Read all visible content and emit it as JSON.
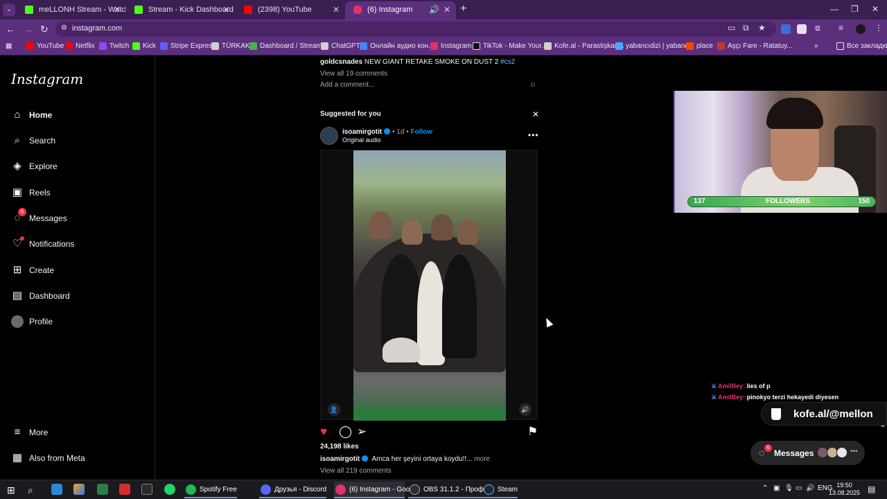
{
  "browser": {
    "tabs": [
      {
        "title": "meLLONH Stream - Watch Live",
        "color": "#53fc18"
      },
      {
        "title": "Stream - Kick Dashboard",
        "color": "#53fc18"
      },
      {
        "title": "(2398) YouTube",
        "color": "#ff0000"
      },
      {
        "title": "(6) Instagram",
        "color": "#e1306c"
      }
    ],
    "url": "instagram.com",
    "bookmarks": [
      {
        "label": "YouTube",
        "color": "#ff0000"
      },
      {
        "label": "Netflix",
        "color": "#e50914"
      },
      {
        "label": "Twitch",
        "color": "#9146ff"
      },
      {
        "label": "Kick",
        "color": "#53fc18"
      },
      {
        "label": "Stripe Express",
        "color": "#635bff"
      },
      {
        "label": "TÜRKAK",
        "color": "#d0d0d0"
      },
      {
        "label": "Dashboard / Stream...",
        "color": "#4caf50"
      },
      {
        "label": "ChatGPT",
        "color": "#d0d0d0"
      },
      {
        "label": "Онлайн аудио кон...",
        "color": "#4285f4"
      },
      {
        "label": "Instagram",
        "color": "#e1306c"
      },
      {
        "label": "TikTok - Make Your...",
        "color": "#111111"
      },
      {
        "label": "Kofe.al - Parastişkarl...",
        "color": "#d0d0d0"
      },
      {
        "label": "yabancıdizi | yabanc...",
        "color": "#4aa8ff"
      },
      {
        "label": "place",
        "color": "#ff4500"
      },
      {
        "label": "Aşçı Fare - Ratatuy...",
        "color": "#c0392b"
      }
    ],
    "all_bookmarks": "Все закладки"
  },
  "instagram": {
    "logo": "Instagram",
    "nav": [
      {
        "label": "Home",
        "icon": "home-icon"
      },
      {
        "label": "Search",
        "icon": "search-icon"
      },
      {
        "label": "Explore",
        "icon": "compass-icon"
      },
      {
        "label": "Reels",
        "icon": "reels-icon"
      },
      {
        "label": "Messages",
        "icon": "messenger-icon",
        "badge": "6"
      },
      {
        "label": "Notifications",
        "icon": "heart-icon"
      },
      {
        "label": "Create",
        "icon": "plus-square-icon"
      },
      {
        "label": "Dashboard",
        "icon": "dashboard-icon"
      },
      {
        "label": "Profile",
        "icon": "avatar-icon"
      }
    ],
    "more": "More",
    "also_from_meta": "Also from Meta",
    "prev_post": {
      "caption_user": "goldcsnades",
      "caption_text": "NEW GIANT RETAKE SMOKE ON DUST 2",
      "hashtag": "#cs2",
      "view_comments": "View all 19 comments",
      "add_comment": "Add a comment..."
    },
    "suggested": "Suggested for you",
    "post": {
      "username": "isoamirgotit",
      "time": "1d",
      "follow": "Follow",
      "audio": "Original audio",
      "likes": "24,198 likes",
      "caption_user": "isoamirgotit",
      "caption_text": "Amca her şeyini ortaya koydu!!...",
      "more": "more",
      "view_comments": "View all 219 comments"
    }
  },
  "overlay": {
    "followers_current": "137",
    "followers_label": "FOLLOWERS",
    "followers_goal": "150",
    "chat": [
      {
        "user": "AmilBey:",
        "text": "lies of p"
      },
      {
        "user": "AmilBey:",
        "text": "pinokyo terzi hekayedi diyesen"
      }
    ],
    "kofe": "kofe.al/@mellon",
    "messages_pill": {
      "label": "Messages",
      "badge": "6"
    }
  },
  "taskbar": {
    "apps": [
      {
        "label": "Spotify Free",
        "color": "#1db954"
      },
      {
        "label": "Друзья - Discord",
        "color": "#5865f2"
      },
      {
        "label": "(6) Instagram - Goo...",
        "color": "#e1306c"
      },
      {
        "label": "OBS 31.1.2 - Проф...",
        "color": "#302e31"
      },
      {
        "label": "Steam",
        "color": "#1b2838"
      }
    ],
    "lang": "ENG",
    "time": "19:50",
    "date": "13.08.2025"
  }
}
